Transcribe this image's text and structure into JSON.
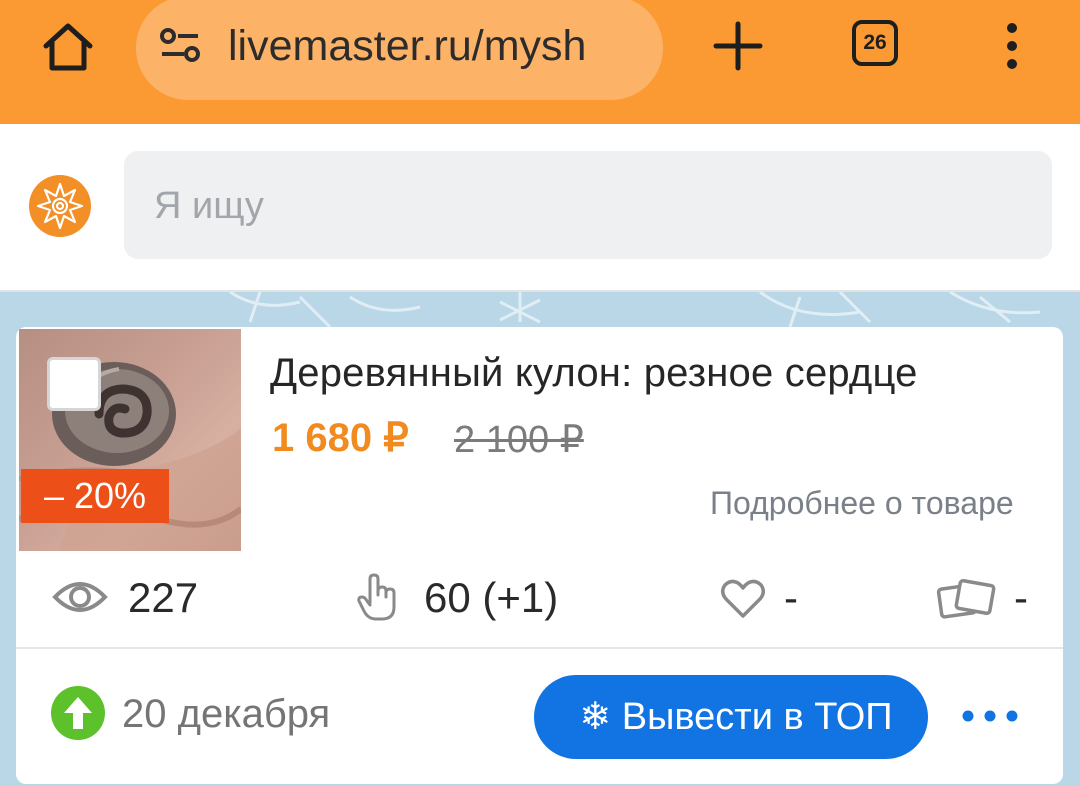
{
  "browser": {
    "url": "livemaster.ru/mysh",
    "tab_count": "26"
  },
  "header": {
    "search_placeholder": "Я ищу"
  },
  "product": {
    "title": "Деревянный кулон: резное сердце",
    "price_current": "1 680 ₽",
    "price_old": "2 100 ₽",
    "discount": "– 20%",
    "details_link": "Подробнее о товаре"
  },
  "stats": {
    "views": "227",
    "clicks": "60 (+1)",
    "favorites": "-",
    "cards": "-"
  },
  "footer": {
    "date": "20 декабря",
    "boost_button": "❄ Вывести в ТОП"
  },
  "colors": {
    "browser_bar": "#fb9a33",
    "price": "#f18a1f",
    "discount_badge": "#ec4f18",
    "primary_button": "#1274e3",
    "boost_icon": "#5cc12a"
  },
  "icons": {
    "home": "home-icon",
    "site_settings": "tune-icon",
    "new_tab": "plus-icon",
    "tabs": "tabs-counter-icon",
    "menu": "kebab-menu-icon",
    "logo": "livemaster-sun-logo",
    "views": "eye-icon",
    "clicks": "pointer-hand-icon",
    "favorites": "heart-icon",
    "cards": "cards-icon",
    "boost": "arrow-up-circle-icon",
    "more": "more-dots-icon"
  }
}
